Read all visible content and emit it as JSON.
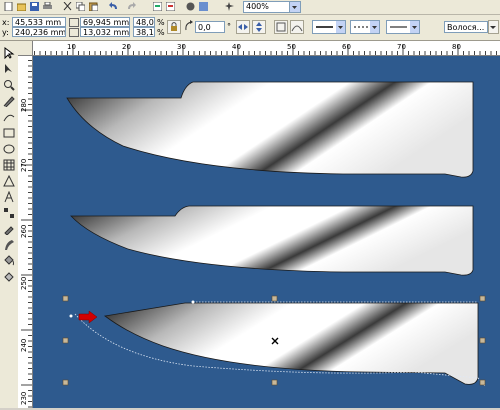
{
  "toolbar": {
    "zoom_value": "400%",
    "icons": [
      "new-icon",
      "open-icon",
      "save-icon",
      "print-icon",
      "cut-icon",
      "copy-icon",
      "paste-icon",
      "undo-icon",
      "redo-icon",
      "import-icon",
      "export-icon",
      "app-launcher-icon",
      "corel-online-icon",
      "zoom-dropdown-icon"
    ]
  },
  "propbar": {
    "x_label": "x:",
    "x_value": "45,533 mm",
    "y_label": "y:",
    "y_value": "240,236 mm",
    "width_value": "69,945 mm",
    "height_value": "13,032 mm",
    "scale_x": "48,0",
    "scale_y": "38,15",
    "scale_unit": "%",
    "rotation_value": "0,0",
    "rotation_unit": "°",
    "outline_label": "Волося..."
  },
  "rulers": {
    "h_ticks": [
      "10",
      "20",
      "30",
      "40",
      "50",
      "60",
      "70",
      "80"
    ],
    "v_ticks": [
      "280",
      "270",
      "260",
      "250",
      "240",
      "230"
    ]
  },
  "colors": {
    "canvas_bg": "#2e5a8e",
    "chrome_bg": "#ece9d8",
    "handle": "#c8b89a",
    "arrow": "#d20000"
  }
}
